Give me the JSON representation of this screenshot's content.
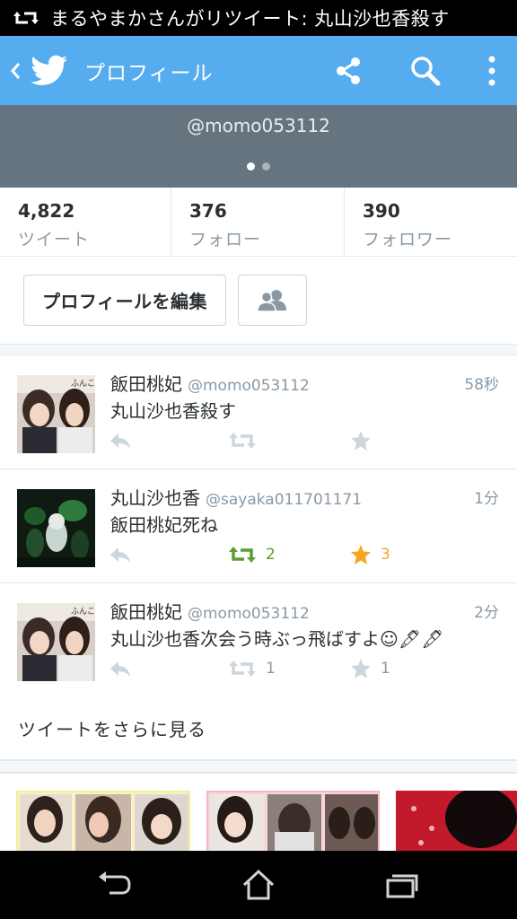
{
  "status_bar": {
    "notification": "まるやまかさんがリツイート: 丸山沙也香殺す"
  },
  "app_bar": {
    "title": "プロフィール",
    "icons": [
      "back-arrow-icon",
      "twitter-bird-icon",
      "share-icon",
      "search-icon",
      "overflow-menu-icon"
    ],
    "color": "#55acee"
  },
  "banner": {
    "handle": "@momo053112",
    "page_indicator": {
      "pages": 2,
      "active": 0
    },
    "color": "#667480"
  },
  "stats": [
    {
      "count": "4,822",
      "label": "ツイート"
    },
    {
      "count": "376",
      "label": "フォロー"
    },
    {
      "count": "390",
      "label": "フォロワー"
    }
  ],
  "actions": {
    "edit_profile_label": "プロフィールを編集",
    "lists_icon": "people-icon"
  },
  "tweets": [
    {
      "name": "飯田桃妃",
      "username": "@momo053112",
      "time": "58秒",
      "text": "丸山沙也香殺す",
      "retweets": "",
      "favorites": "",
      "retweeted": false,
      "favorited": false
    },
    {
      "name": "丸山沙也香",
      "username": "@sayaka011701171",
      "time": "1分",
      "text": "飯田桃妃死ね",
      "retweets": "2",
      "favorites": "3",
      "retweeted": true,
      "favorited": true
    },
    {
      "name": "飯田桃妃",
      "username": "@momo053112",
      "time": "2分",
      "text": "丸山沙也香次会う時ぶっ飛ばすよ☺🖋🖋",
      "retweets": "1",
      "favorites": "1",
      "retweeted": false,
      "favorited": false
    }
  ],
  "more_tweets_label": "ツイートをさらに見る",
  "colors": {
    "retweet_active": "#5c9f30",
    "favorite_active": "#f5a623",
    "action_inactive": "#ccd6dd",
    "meta_text": "#8899a6"
  },
  "nav_bar": {
    "icons": [
      "back-icon",
      "home-icon",
      "recent-apps-icon"
    ]
  }
}
